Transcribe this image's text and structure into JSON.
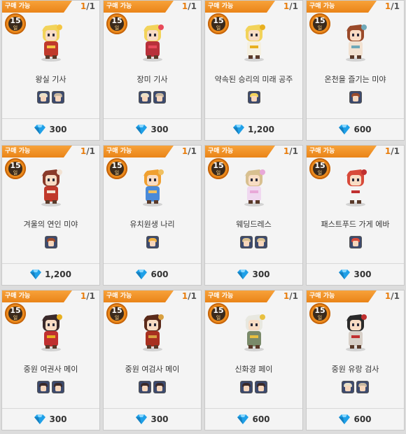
{
  "shop": {
    "items": [
      {
        "tag": "구매 가능",
        "stock_current": "1",
        "stock_total": "/1",
        "level": "15",
        "level_unit": "일",
        "name": "왕실 기사",
        "price": "300",
        "skins": [
          "#e8e0c8",
          "#c8b8a0"
        ],
        "sprite": {
          "hair": "#f2d35a",
          "cloth": "#c0392b",
          "accent": "#f4c542"
        }
      },
      {
        "tag": "구매 가능",
        "stock_current": "1",
        "stock_total": "/1",
        "level": "15",
        "level_unit": "일",
        "name": "장미 기사",
        "price": "300",
        "skins": [
          "#e8e0c8",
          "#c8b8a0"
        ],
        "sprite": {
          "hair": "#f2d35a",
          "cloth": "#b8303a",
          "accent": "#e84a5a"
        }
      },
      {
        "tag": "구매 가능",
        "stock_current": "1",
        "stock_total": "/1",
        "level": "15",
        "level_unit": "일",
        "name": "약속된 승리의 미래 공주",
        "price": "1,200",
        "skins": [
          "#f2d35a"
        ],
        "sprite": {
          "hair": "#f2d35a",
          "cloth": "#f5f0e0",
          "accent": "#e8b020"
        }
      },
      {
        "tag": "구매 가능",
        "stock_current": "1",
        "stock_total": "/1",
        "level": "15",
        "level_unit": "일",
        "name": "온천을 즐기는 미야",
        "price": "600",
        "skins": [
          "#9a4a2a"
        ],
        "sprite": {
          "hair": "#9a4a2a",
          "cloth": "#f2e2d2",
          "accent": "#6fa8b8"
        }
      },
      {
        "tag": "구매 가능",
        "stock_current": "1",
        "stock_total": "/1",
        "level": "15",
        "level_unit": "일",
        "name": "겨울의 연인 미야",
        "price": "1,200",
        "skins": [
          "#9a4a2a"
        ],
        "sprite": {
          "hair": "#8a3a2a",
          "cloth": "#c0392b",
          "accent": "#f2e2d2"
        }
      },
      {
        "tag": "구매 가능",
        "stock_current": "1",
        "stock_total": "/1",
        "level": "15",
        "level_unit": "일",
        "name": "유치원생 나리",
        "price": "600",
        "skins": [
          "#f0b040"
        ],
        "sprite": {
          "hair": "#f0a030",
          "cloth": "#4a8ad8",
          "accent": "#f0c060"
        }
      },
      {
        "tag": "구매 가능",
        "stock_current": "1",
        "stock_total": "/1",
        "level": "15",
        "level_unit": "일",
        "name": "웨딩드레스",
        "price": "300",
        "skins": [
          "#d8c090",
          "#d8c090"
        ],
        "sprite": {
          "hair": "#d8c090",
          "cloth": "#f0d8f0",
          "accent": "#e8a8d8"
        }
      },
      {
        "tag": "구매 가능",
        "stock_current": "1",
        "stock_total": "/1",
        "level": "15",
        "level_unit": "일",
        "name": "패스트푸드 가게 에바",
        "price": "300",
        "skins": [
          "#d84a3a"
        ],
        "sprite": {
          "hair": "#d84a3a",
          "cloth": "#f4f4f4",
          "accent": "#c03030"
        }
      },
      {
        "tag": "구매 가능",
        "stock_current": "1",
        "stock_total": "/1",
        "level": "15",
        "level_unit": "일",
        "name": "중원 여권사 메이",
        "price": "300",
        "skins": [
          "#3a2a2a",
          "#3a2a2a"
        ],
        "sprite": {
          "hair": "#3a2a2a",
          "cloth": "#c03030",
          "accent": "#e8b020"
        }
      },
      {
        "tag": "구매 가능",
        "stock_current": "1",
        "stock_total": "/1",
        "level": "15",
        "level_unit": "일",
        "name": "중원 여검사 메이",
        "price": "300",
        "skins": [
          "#3a2a2a",
          "#3a2a2a"
        ],
        "sprite": {
          "hair": "#5a2a1a",
          "cloth": "#a83020",
          "accent": "#d8a040"
        }
      },
      {
        "tag": "구매 가능",
        "stock_current": "1",
        "stock_total": "/1",
        "level": "15",
        "level_unit": "일",
        "name": "신화경 페이",
        "price": "600",
        "skins": [
          "#3a2a2a",
          "#3a2a2a"
        ],
        "sprite": {
          "hair": "#e8e8e0",
          "cloth": "#7a8a6a",
          "accent": "#e8c040"
        }
      },
      {
        "tag": "구매 가능",
        "stock_current": "1",
        "stock_total": "/1",
        "level": "15",
        "level_unit": "일",
        "name": "중원 유랑 검사",
        "price": "600",
        "skins": [
          "#e8e0c8",
          "#c8b8a0"
        ],
        "sprite": {
          "hair": "#2a2a2a",
          "cloth": "#d8d0c8",
          "accent": "#c03030"
        }
      }
    ]
  },
  "colors": {
    "tag": "#ea8418",
    "gem": "#1fa0e8",
    "stock_accent": "#e87d0d"
  },
  "icons": {
    "badge": "level-badge-icon",
    "gem": "diamond-gem-icon"
  }
}
